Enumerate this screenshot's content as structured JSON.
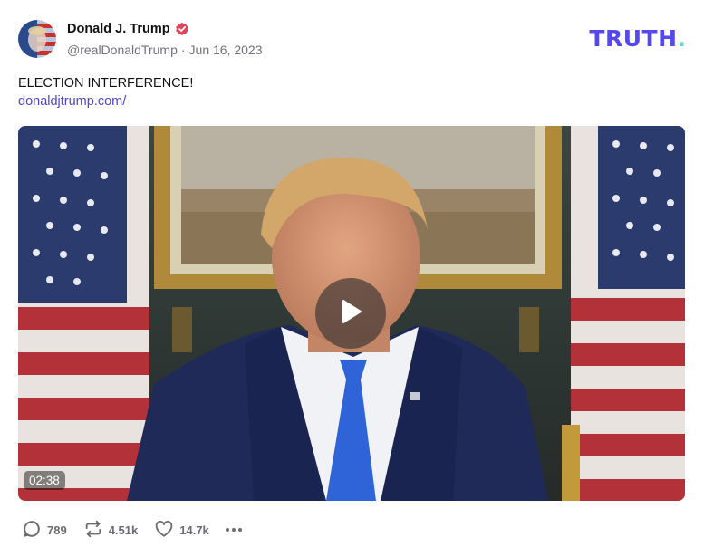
{
  "author": {
    "display_name": "Donald J. Trump",
    "handle": "@realDonaldTrump",
    "separator": "·",
    "date": "Jun 16, 2023"
  },
  "brand": {
    "logo_text": "TRUTH",
    "logo_dot": ".",
    "accent_color": "#5448ee",
    "dot_color": "#65d9c4"
  },
  "post": {
    "text": "ELECTION INTERFERENCE!",
    "link": "donaldjtrump.com/"
  },
  "media": {
    "type": "video",
    "duration": "02:38",
    "play_icon": "play-icon"
  },
  "actions": {
    "replies": "789",
    "retruths": "4.51k",
    "likes": "14.7k"
  },
  "colors": {
    "link": "#4f46c8",
    "verified": "#e0455b",
    "meta": "#71717a"
  }
}
